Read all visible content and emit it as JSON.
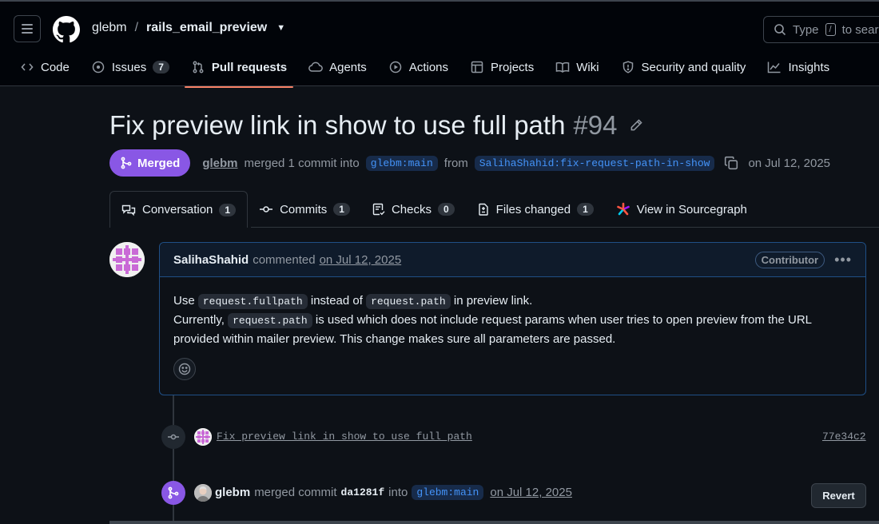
{
  "header": {
    "owner": "glebm",
    "separator": "/",
    "repo": "rails_email_preview",
    "search_placeholder": "Type",
    "search_kbd": "/",
    "search_suffix": "to sear"
  },
  "nav": {
    "items": [
      {
        "label": "Code",
        "icon": "code-icon"
      },
      {
        "label": "Issues",
        "icon": "issue-opened-icon",
        "count": "7"
      },
      {
        "label": "Pull requests",
        "icon": "git-pull-request-icon",
        "active": true
      },
      {
        "label": "Agents",
        "icon": "cloud-icon"
      },
      {
        "label": "Actions",
        "icon": "play-icon"
      },
      {
        "label": "Projects",
        "icon": "table-icon"
      },
      {
        "label": "Wiki",
        "icon": "book-icon"
      },
      {
        "label": "Security and quality",
        "icon": "shield-icon"
      },
      {
        "label": "Insights",
        "icon": "graph-icon"
      }
    ]
  },
  "pr": {
    "title": "Fix preview link in show to use full path",
    "number": "#94",
    "state": "Merged",
    "merged_by": "glebm",
    "merged_text": "merged 1 commit into",
    "base_branch": "glebm:main",
    "from_text": "from",
    "head_branch": "SalihaShahid:fix-request-path-in-show",
    "date": "on Jul 12, 2025"
  },
  "tabs": [
    {
      "label": "Conversation",
      "count": "1",
      "icon": "comment-discussion-icon"
    },
    {
      "label": "Commits",
      "count": "1",
      "icon": "git-commit-icon"
    },
    {
      "label": "Checks",
      "count": "0",
      "icon": "checklist-icon"
    },
    {
      "label": "Files changed",
      "count": "1",
      "icon": "file-diff-icon"
    },
    {
      "label": "View in Sourcegraph",
      "icon": "sourcegraph-icon"
    }
  ],
  "comment": {
    "author": "SalihaShahid",
    "action": "commented",
    "when": "on Jul 12, 2025",
    "role": "Contributor",
    "line1_a": "Use",
    "code1": "request.fullpath",
    "line1_b": "instead of",
    "code2": "request.path",
    "line1_c": "in preview link.",
    "line2_a": "Currently,",
    "code3": "request.path",
    "line2_b": "is used which does not include request params when user tries to open preview from the URL provided within mailer preview. This change makes sure all parameters are passed."
  },
  "timeline": {
    "commit_message": "Fix preview link in show to use full path",
    "commit_sha": "77e34c2",
    "merge_user": "glebm",
    "merge_text": "merged commit",
    "merge_sha": "da1281f",
    "into_text": "into",
    "merge_branch": "glebm:main",
    "merge_when": "on Jul 12, 2025",
    "revert_label": "Revert"
  },
  "colors": {
    "merged": "#8957e5",
    "accent_underline": "#f78166",
    "branch_text": "#4493f8"
  }
}
